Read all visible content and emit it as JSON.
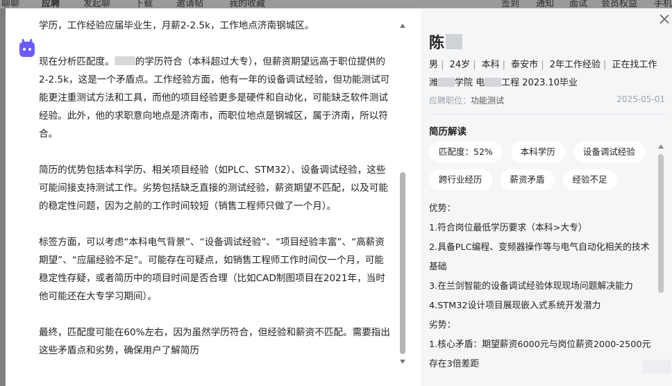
{
  "background_nav": {
    "items": [
      "聊聊",
      "应聘",
      "发起聊",
      "下载",
      "邀请帖",
      "我的收藏",
      "签到",
      "通知",
      "面试",
      "会员权益",
      "手机"
    ]
  },
  "chat": {
    "paragraphs": [
      "学历，工作经验应届毕业生，月薪2-2.5k，工作地点济南钢城区。",
      [
        "现在分析匹配度。",
        "的学历符合（本科超过大专），但薪资期望远高于职位提供的2-2.5k，这是一个矛盾点。工作经验方面，他有一年的设备调试经验，但功能测试可能更注重测试方法和工具，而他的项目经验更多是硬件和自动化，可能缺乏软件测试经验。此外，他的求职意向地点是济南市，而职位地点是钢城区，属于济南，所以符合。"
      ],
      "简历的优势包括本科学历、相关项目经验（如PLC、STM32）、设备调试经验，这些可能间接支持测试工作。劣势包括缺乏直接的测试经验，薪资期望不匹配，以及可能的稳定性问题，因为之前的工作时间较短（销售工程师只做了一个月）。",
      "标签方面，可以考虑“本科电气背景”、“设备调试经验”、“项目经验丰富”、“高薪资期望”、“应届经验不足”。可能存在可疑点，如销售工程师工作时间仅一个月，可能稳定性存疑，或者简历中的项目时间是否合理（比如CAD制图项目在2021年，当时他可能还在大专学习期间）。",
      "最终，匹配度可能在60%左右，因为虽然学历符合，但经验和薪资不匹配。需要指出这些矛盾点和劣势，确保用户了解简历"
    ]
  },
  "resume": {
    "name_visible": "陈",
    "info": [
      "男",
      "24岁",
      "本科",
      "泰安市",
      "2年工作经验",
      "正在找工作"
    ],
    "edu_prefix": "潍",
    "edu_mid": "学院 电",
    "edu_suffix": "工程  2023.10毕业",
    "apply_label": "应聘职位：",
    "apply_position": "功能测试",
    "apply_date": "2025-05-01",
    "section_title": "简历解读",
    "tags": [
      "匹配度：52%",
      "本科学历",
      "设备调试经验",
      "跨行业经历",
      "薪资矛盾",
      "经验不足"
    ],
    "strengths_title": "优势：",
    "strengths": [
      "1.符合岗位最低学历要求（本科>大专）",
      "2.具备PLC编程、变频器操作等与电气自动化相关的技术基础",
      "3.在兰剑智能的设备调试经验体现现场问题解决能力",
      "4.STM32设计项目展现嵌入式系统开发潜力"
    ],
    "weaknesses_title": "劣势：",
    "weaknesses": [
      "1.核心矛盾：期望薪资6000元与岗位薪资2000-2500元存在3倍差距"
    ]
  }
}
